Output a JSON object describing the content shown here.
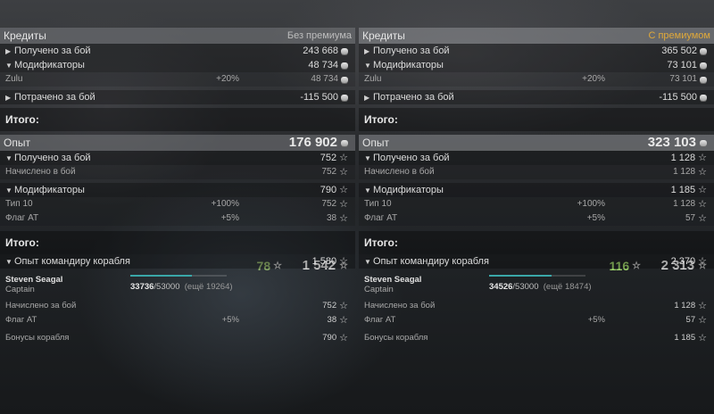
{
  "left": {
    "credits": {
      "title": "Кредиты",
      "mode": "Без премиума",
      "earned": {
        "label": "Получено за бой",
        "value": "243 668"
      },
      "modifiers": {
        "label": "Модификаторы",
        "value": "48 734"
      },
      "zulu": {
        "label": "Zulu",
        "pct": "+20%",
        "value": "48 734"
      },
      "spent": {
        "label": "Потрачено за бой",
        "value": "-115 500"
      },
      "total": {
        "label": "Итого:",
        "value": "176 902"
      }
    },
    "exp": {
      "title": "Опыт",
      "earned": {
        "label": "Получено за бой",
        "value": "752"
      },
      "accrued": {
        "label": "Начислено в бой",
        "value": "752"
      },
      "modifiers": {
        "label": "Модификаторы",
        "value": "790"
      },
      "tier": {
        "label": "Тип 10",
        "pct": "+100%",
        "value": "752"
      },
      "flag": {
        "label": "Флаг AT",
        "pct": "+5%",
        "value": "38"
      },
      "total": {
        "label": "Итого:",
        "free": "78",
        "value": "1 542"
      },
      "commander": {
        "label": "Опыт командиру корабля",
        "value": "1 580"
      }
    },
    "captain": {
      "name": "Steven Seagal",
      "rank": "Captain",
      "xp": "33736",
      "xp_max": "/53000",
      "xp_rest": "(ещё 19264)",
      "progress": 0.64,
      "accrued": {
        "label": "Начислено за бой",
        "value": "752"
      },
      "flag": {
        "label": "Флаг AT",
        "pct": "+5%",
        "value": "38"
      },
      "bonus": {
        "label": "Бонусы корабля",
        "value": "790"
      }
    }
  },
  "right": {
    "credits": {
      "title": "Кредиты",
      "mode": "С премиумом",
      "earned": {
        "label": "Получено за бой",
        "value": "365 502"
      },
      "modifiers": {
        "label": "Модификаторы",
        "value": "73 101"
      },
      "zulu": {
        "label": "Zulu",
        "pct": "+20%",
        "value": "73 101"
      },
      "spent": {
        "label": "Потрачено за бой",
        "value": "-115 500"
      },
      "total": {
        "label": "Итого:",
        "value": "323 103"
      }
    },
    "exp": {
      "title": "Опыт",
      "earned": {
        "label": "Получено за бой",
        "value": "1 128"
      },
      "accrued": {
        "label": "Начислено в бой",
        "value": "1 128"
      },
      "modifiers": {
        "label": "Модификаторы",
        "value": "1 185"
      },
      "tier": {
        "label": "Тип 10",
        "pct": "+100%",
        "value": "1 128"
      },
      "flag": {
        "label": "Флаг AT",
        "pct": "+5%",
        "value": "57"
      },
      "total": {
        "label": "Итого:",
        "free": "116",
        "value": "2 313"
      },
      "commander": {
        "label": "Опыт командиру корабля",
        "value": "2 370"
      }
    },
    "captain": {
      "name": "Steven Seagal",
      "rank": "Captain",
      "xp": "34526",
      "xp_max": "/53000",
      "xp_rest": "(ещё 18474)",
      "progress": 0.65,
      "accrued": {
        "label": "Начислено за бой",
        "value": "1 128"
      },
      "flag": {
        "label": "Флаг AT",
        "pct": "+5%",
        "value": "57"
      },
      "bonus": {
        "label": "Бонусы корабля",
        "value": "1 185"
      }
    }
  },
  "colors": {
    "premium": "#e0a93a",
    "progress": "#3aa7a8",
    "free_xp": "#9bd26a"
  },
  "icons": {
    "credit": "credit-coin-icon",
    "xp": "star-icon",
    "expand": "triangle-right-icon",
    "collapse": "triangle-down-icon"
  }
}
